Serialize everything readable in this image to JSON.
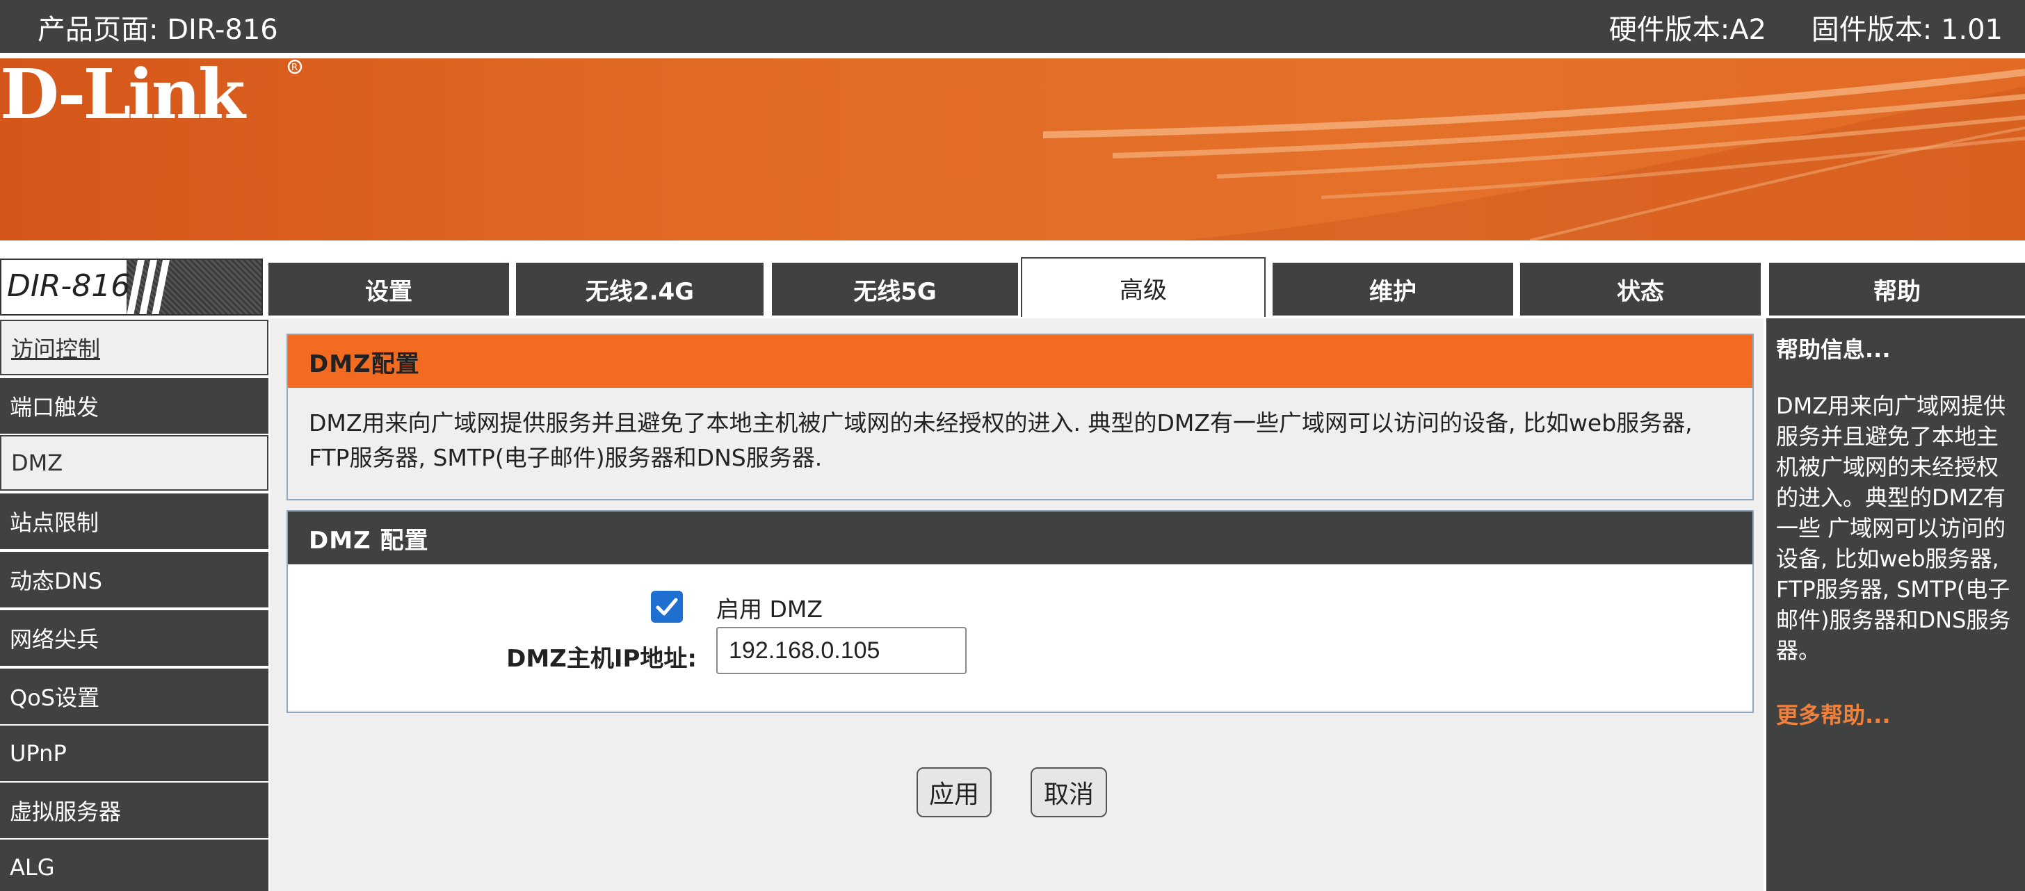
{
  "header": {
    "product": "产品页面: DIR-816",
    "hardware_version": "硬件版本:A2",
    "firmware_version": "固件版本: 1.01"
  },
  "brand": {
    "logo": "D-Link",
    "model": "DIR-816",
    "accent_color": "#f26b21",
    "dark_color": "#404242"
  },
  "tabs": [
    {
      "label": "设置"
    },
    {
      "label": "无线2.4G"
    },
    {
      "label": "无线5G"
    },
    {
      "label": "高级",
      "active": true
    },
    {
      "label": "维护"
    },
    {
      "label": "状态"
    },
    {
      "label": "帮助"
    }
  ],
  "sidebar": {
    "items": [
      {
        "label": "访问控制"
      },
      {
        "label": "端口触发"
      },
      {
        "label": "DMZ",
        "selected": true
      },
      {
        "label": "站点限制"
      },
      {
        "label": "动态DNS"
      },
      {
        "label": "网络尖兵"
      },
      {
        "label": "QoS设置"
      },
      {
        "label": "UPnP"
      },
      {
        "label": "虚拟服务器"
      },
      {
        "label": "ALG"
      }
    ]
  },
  "intro": {
    "title": "DMZ配置",
    "description": "DMZ用来向广域网提供服务并且避免了本地主机被广域网的未经授权的进入. 典型的DMZ有一些广域网可以访问的设备, 比如web服务器, FTP服务器, SMTP(电子邮件)服务器和DNS服务器."
  },
  "dmz_form": {
    "title": "DMZ 配置",
    "enable_label": "启用 DMZ",
    "enabled": true,
    "ip_label": "DMZ主机IP地址:",
    "ip_value": "192.168.0.105"
  },
  "buttons": {
    "apply": "应用",
    "cancel": "取消"
  },
  "help": {
    "title": "帮助信息...",
    "text": "DMZ用来向广域网提供服务并且避免了本地主机被广域网的未经授权的进入。典型的DMZ有一些 广域网可以访问的设备, 比如web服务器, FTP服务器, SMTP(电子邮件)服务器和DNS服务器。",
    "more": "更多帮助..."
  }
}
